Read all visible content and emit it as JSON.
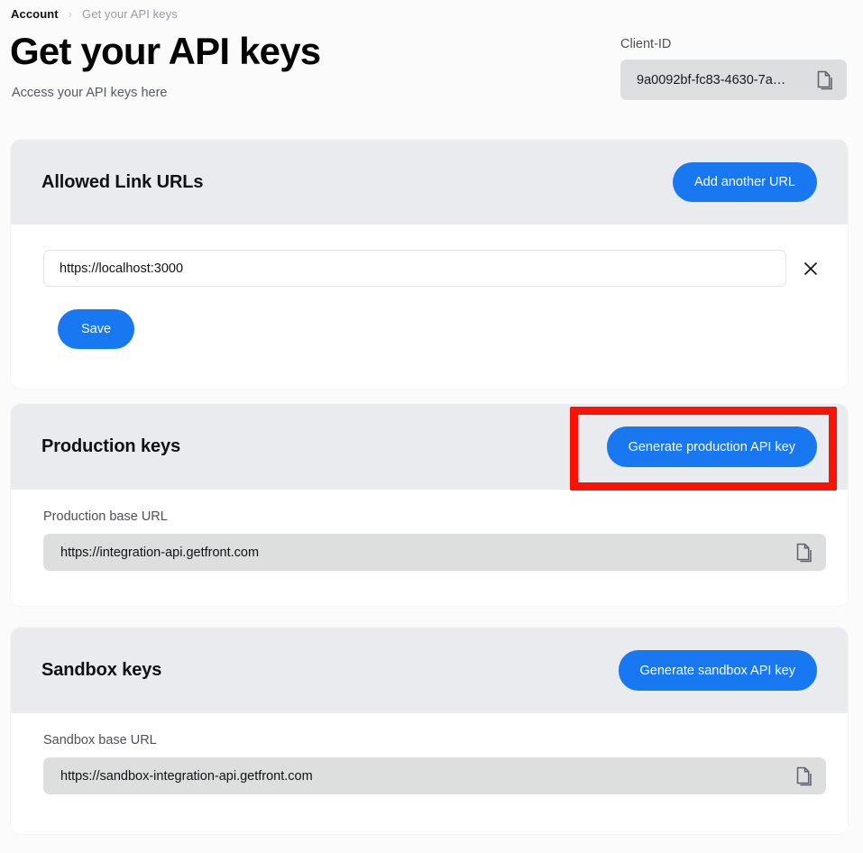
{
  "breadcrumb": {
    "current": "Account",
    "separator": "›",
    "next": "Get your API keys"
  },
  "header": {
    "title": "Get your API keys",
    "subtitle": "Access your API keys here"
  },
  "client_id": {
    "label": "Client-ID",
    "value": "9a0092bf-fc83-4630-7a…",
    "copy_icon": "copy-icon"
  },
  "colors": {
    "accent_blue": "#1778f2",
    "card_header_bg": "#eaebef",
    "card_body_bg": "#ffffff",
    "page_bg": "#fbfbfb",
    "field_gray": "#dddede",
    "annotation_red": "#fc1204"
  },
  "allowed_urls_card": {
    "title": "Allowed Link URLs",
    "add_button": "Add another URL",
    "url_entries": [
      {
        "value": "https://localhost:3000",
        "placeholder": "https://",
        "remove_icon": "close-icon"
      }
    ],
    "save_button": "Save"
  },
  "production_card": {
    "title": "Production keys",
    "generate_button": "Generate production API key",
    "base_url_label": "Production base URL",
    "base_url_value": "https://integration-api.getfront.com",
    "copy_icon": "copy-icon"
  },
  "sandbox_card": {
    "title": "Sandbox keys",
    "generate_button": "Generate sandbox API key",
    "base_url_label": "Sandbox base URL",
    "base_url_value": "https://sandbox-integration-api.getfront.com",
    "copy_icon": "copy-icon"
  },
  "annotation": {
    "target": "generate-production-api-key-button",
    "shape": "rectangle",
    "color": "#fc1204"
  }
}
